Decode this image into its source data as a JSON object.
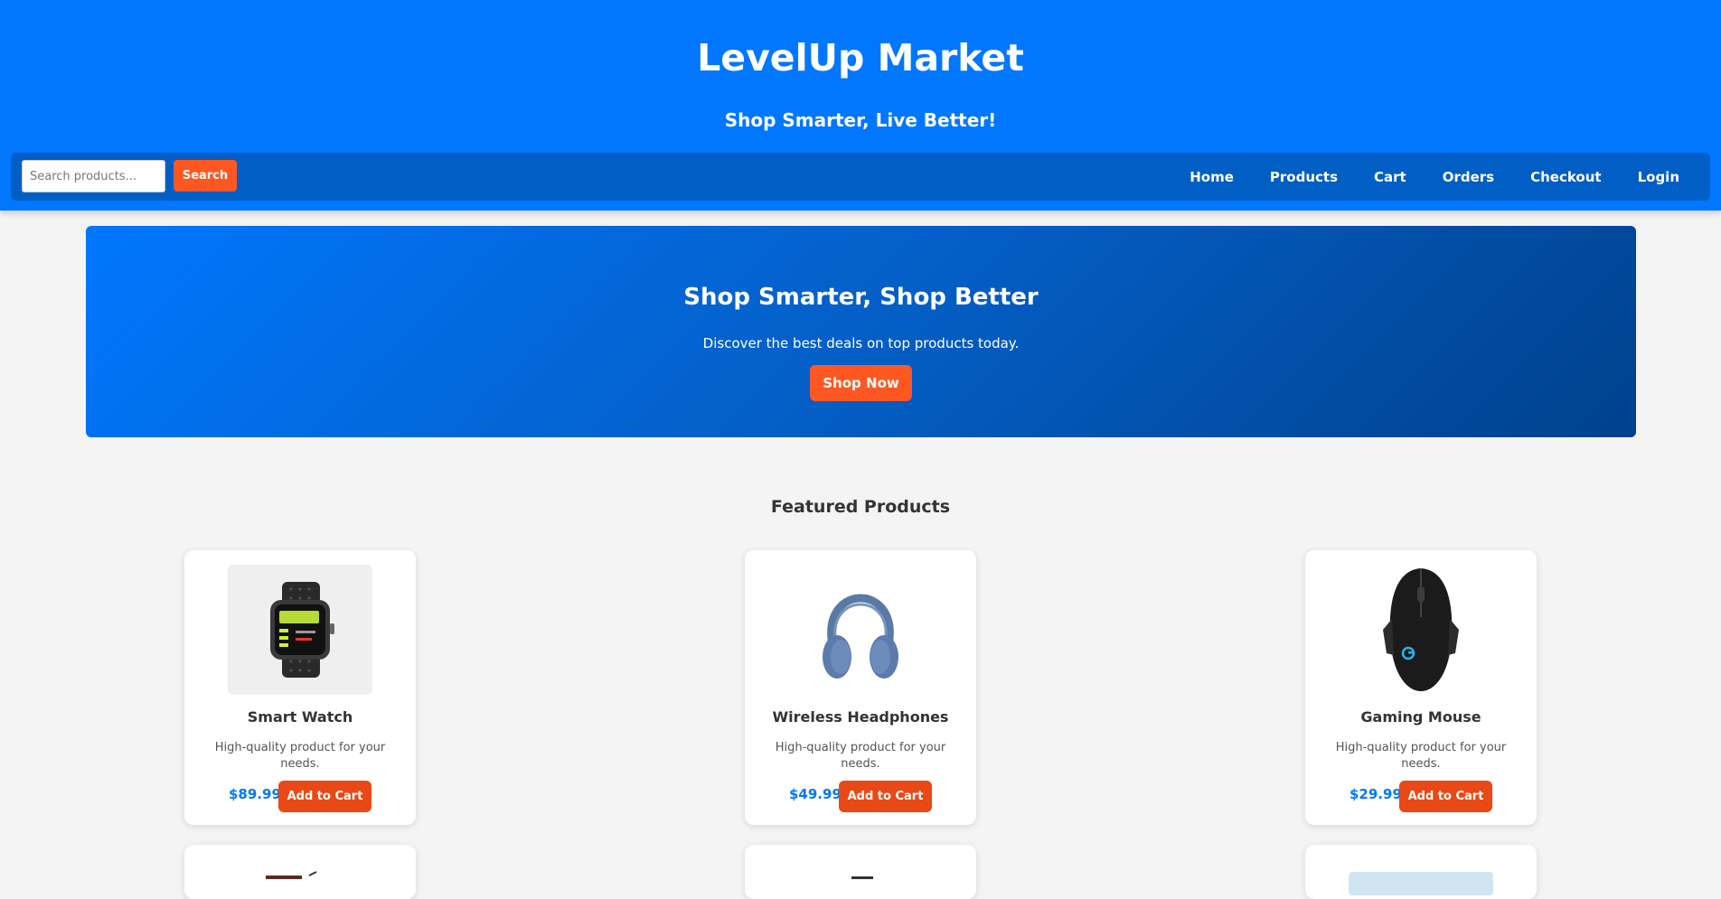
{
  "header": {
    "brand": "LevelUp Market",
    "tagline": "Shop Smarter, Live Better!"
  },
  "search": {
    "placeholder": "Search products...",
    "button_label": "Search"
  },
  "nav": {
    "items": [
      {
        "label": "Home"
      },
      {
        "label": "Products"
      },
      {
        "label": "Cart"
      },
      {
        "label": "Orders"
      },
      {
        "label": "Checkout"
      },
      {
        "label": "Login"
      }
    ]
  },
  "hero": {
    "title": "Shop Smarter, Shop Better",
    "text": "Discover the best deals on top products today.",
    "button_label": "Shop Now"
  },
  "featured": {
    "title": "Featured Products",
    "products": [
      {
        "name": "Smart Watch",
        "description": "High-quality product for your needs.",
        "price": "$89.99",
        "button_label": "Add to Cart",
        "icon": "smart-watch-image"
      },
      {
        "name": "Wireless Headphones",
        "description": "High-quality product for your needs.",
        "price": "$49.99",
        "button_label": "Add to Cart",
        "icon": "headphones-image"
      },
      {
        "name": "Gaming Mouse",
        "description": "High-quality product for your needs.",
        "price": "$29.99",
        "button_label": "Add to Cart",
        "icon": "gaming-mouse-image"
      }
    ]
  },
  "colors": {
    "primary": "#0077fe",
    "nav_bg": "#005ec5",
    "accent": "#ff5722",
    "background": "#f4f4f4"
  }
}
